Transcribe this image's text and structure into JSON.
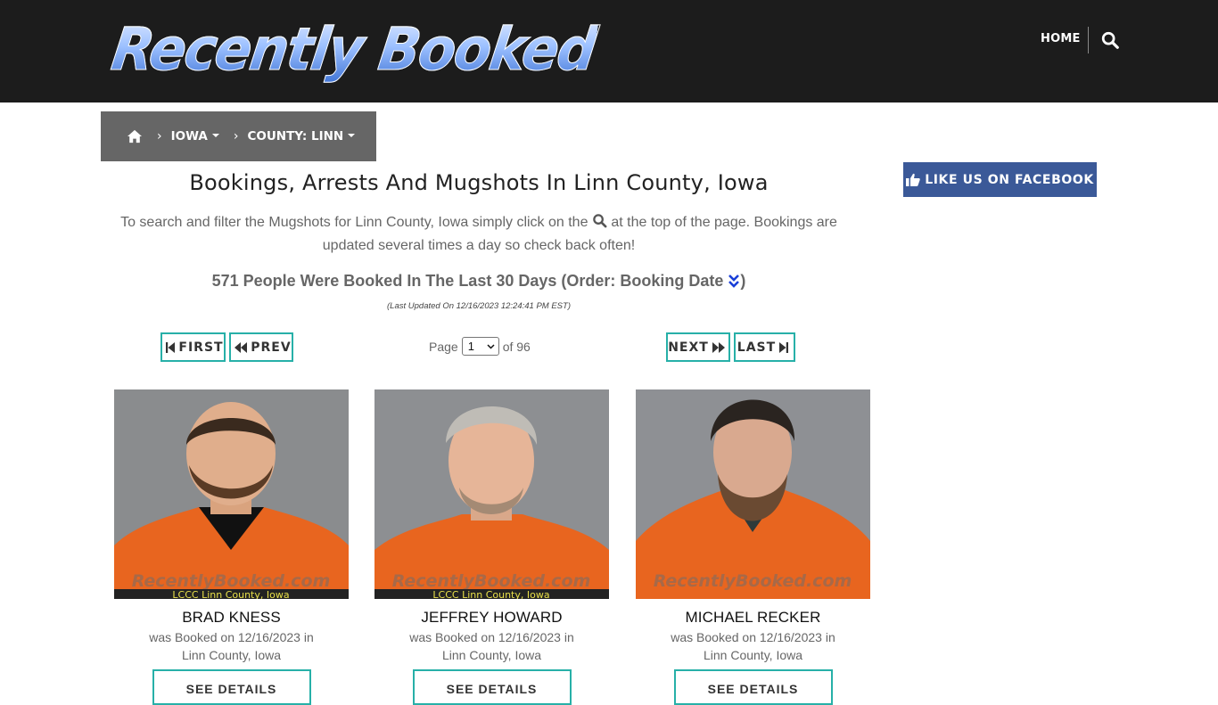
{
  "header": {
    "logo_text": "Recently Booked",
    "nav_home": "HOME"
  },
  "breadcrumb": {
    "state": "IOWA",
    "county": "COUNTY: LINN"
  },
  "facebook": {
    "label": "LIKE US ON FACEBOOK"
  },
  "main": {
    "title": "Bookings, Arrests And Mugshots In Linn County, Iowa",
    "intro_before": "To search and filter the Mugshots for Linn County, Iowa simply click on the",
    "intro_after": "at the top of the page. Bookings are updated several times a day so check back often!",
    "count_text": "571 People Were Booked In The Last 30 Days (Order: Booking Date",
    "count_close": ")",
    "updated": "(Last Updated On 12/16/2023 12:24:41 PM EST)"
  },
  "pagination": {
    "first": "FIRST",
    "prev": "PREV",
    "next": "NEXT",
    "last": "LAST",
    "page_label": "Page",
    "current_page": "1",
    "of_label": "of 96"
  },
  "bookings": [
    {
      "name": "BRAD KNESS",
      "line1": "was Booked on 12/16/2023 in",
      "line2": "Linn County, Iowa",
      "button": "SEE DETAILS",
      "watermark": "RecentlyBooked.com",
      "caption": "LCCC Linn County, Iowa"
    },
    {
      "name": "JEFFREY HOWARD",
      "line1": "was Booked on 12/16/2023 in",
      "line2": "Linn County, Iowa",
      "button": "SEE DETAILS",
      "watermark": "RecentlyBooked.com",
      "caption": "LCCC Linn County, Iowa"
    },
    {
      "name": "MICHAEL RECKER",
      "line1": "was Booked on 12/16/2023 in",
      "line2": "Linn County, Iowa",
      "button": "SEE DETAILS",
      "watermark": "RecentlyBooked.com",
      "caption": "LCCC Linn County, Iowa"
    }
  ],
  "colors": {
    "header_bg": "#1c1c1c",
    "breadcrumb_bg": "#666666",
    "facebook_bg": "#3b5998",
    "button_border": "#27b0a8",
    "jumpsuit": "#e8651f"
  },
  "icons": [
    "home-icon",
    "search-icon",
    "chevron-right-icon",
    "thumbs-up-icon",
    "double-chevron-down-icon",
    "step-backward-icon",
    "backward-icon",
    "forward-icon",
    "step-forward-icon"
  ]
}
